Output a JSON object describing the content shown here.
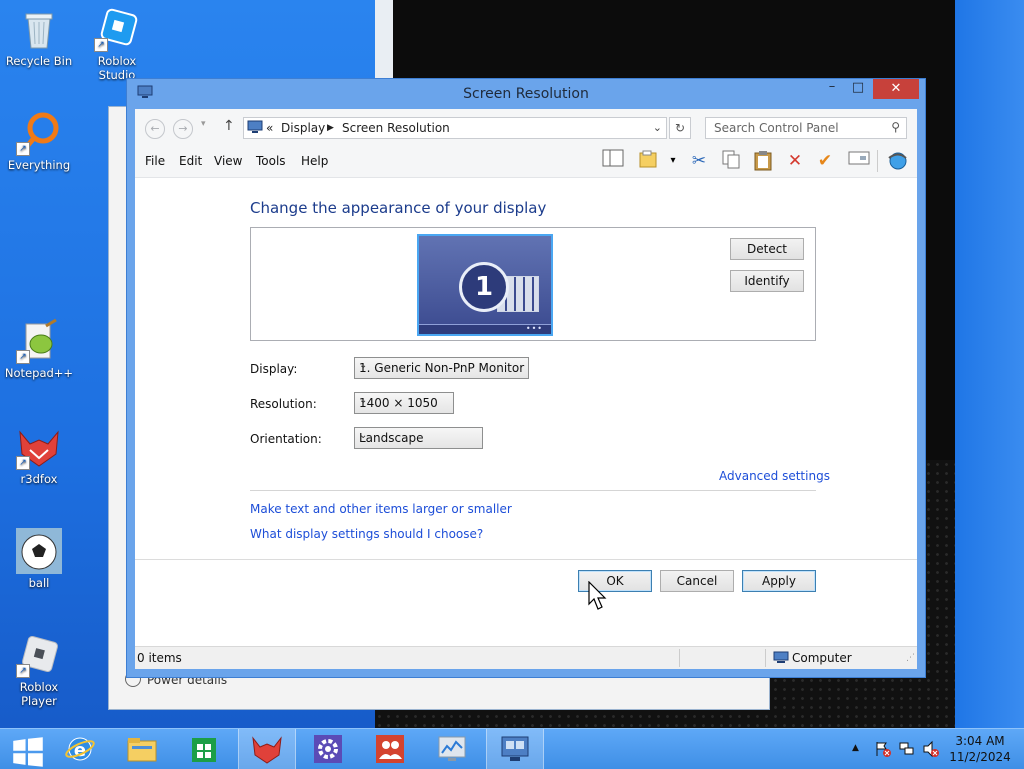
{
  "desktop": {
    "icons": [
      {
        "label": "Recycle Bin"
      },
      {
        "label": "Roblox Studio"
      },
      {
        "label": "Everything"
      },
      {
        "label": "Notepad++"
      },
      {
        "label": "r3dfox"
      },
      {
        "label": "ball"
      },
      {
        "label": "Roblox Player"
      }
    ],
    "background_window_text": "Power details"
  },
  "window": {
    "title": "Screen Resolution",
    "controls": {
      "minimize": "–",
      "maximize": "□",
      "close": "✕"
    },
    "address": {
      "prefix": "«",
      "crumbs": [
        "Display",
        "Screen Resolution"
      ],
      "search_placeholder": "Search Control Panel"
    },
    "menu": [
      "File",
      "Edit",
      "View",
      "Tools",
      "Help"
    ],
    "heading": "Change the appearance of your display",
    "monitor_number": "1",
    "buttons": {
      "detect": "Detect",
      "identify": "Identify",
      "ok": "OK",
      "cancel": "Cancel",
      "apply": "Apply"
    },
    "fields": {
      "display": {
        "label": "Display:",
        "value": "1. Generic Non-PnP Monitor"
      },
      "resolution": {
        "label": "Resolution:",
        "value": "1400 × 1050"
      },
      "orientation": {
        "label": "Orientation:",
        "value": "Landscape"
      }
    },
    "links": {
      "advanced": "Advanced settings",
      "text_size": "Make text and other items larger or smaller",
      "which_settings": "What display settings should I choose?"
    },
    "status": {
      "items": "0 items",
      "location": "Computer"
    }
  },
  "taskbar": {
    "clock": {
      "time": "3:04 AM",
      "date": "11/2/2024"
    },
    "tray_arrow": "▲"
  },
  "colors": {
    "accent_link": "#1d4ed8",
    "heading": "#1c3c8c",
    "window_frame": "#6aa4eb",
    "close_button": "#c7413b",
    "taskbar": "#4a98ee"
  }
}
